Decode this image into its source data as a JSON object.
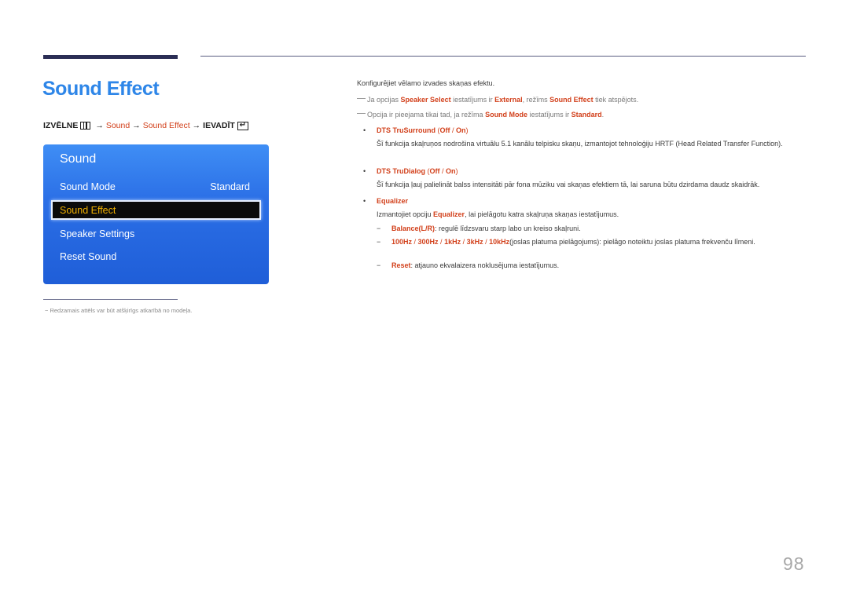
{
  "page": {
    "title": "Sound Effect",
    "page_number": "98"
  },
  "breadcrumb": {
    "menu_label": "IZVĒLNE",
    "menu_icon": "menu-grid-icon",
    "arrow": "→",
    "step1": "Sound",
    "step2": "Sound Effect",
    "enter_label": "IEVADĪT",
    "enter_icon": "enter-return-icon",
    "enter_glyph": "↵"
  },
  "osd_menu": {
    "title": "Sound",
    "items": [
      {
        "label": "Sound Mode",
        "value": "Standard"
      },
      {
        "label": "Sound Effect",
        "value": "",
        "selected": true
      },
      {
        "label": "Speaker Settings",
        "value": ""
      },
      {
        "label": "Reset Sound",
        "value": ""
      }
    ]
  },
  "footnote": "− Redzamais attēls var būt atšķirīgs atkarībā no modeļa.",
  "content": {
    "intro": "Konfigurējiet vēlamo izvades skaņas efektu.",
    "note1": {
      "t1": "Ja opcijas ",
      "k1": "Speaker Select",
      "t2": " iestatījums ir ",
      "k2": "External",
      "t3": ", režīms ",
      "k3": "Sound Effect",
      "t4": " tiek atspējots."
    },
    "note2": {
      "t1": "Opcija ir pieejama tikai tad, ja režīma ",
      "k1": "Sound Mode",
      "t2": " iestatījums ir ",
      "k2": "Standard",
      "t3": "."
    },
    "bullets": [
      {
        "name": "DTS TruSurround",
        "opt_open": " (",
        "opt1": "Off",
        "sep": " / ",
        "opt2": "On",
        "opt_close": ")",
        "desc": "Šī funkcija skaļruņos nodrošina virtuālu 5.1 kanālu telpisku skaņu, izmantojot tehnoloģiju HRTF (Head Related Transfer Function)."
      },
      {
        "name": "DTS TruDialog",
        "opt_open": " (",
        "opt1": "Off",
        "sep": " / ",
        "opt2": "On",
        "opt_close": ")",
        "desc": "Šī funkcija ļauj palielināt balss intensitāti pār fona mūziku vai skaņas efektiem tā, lai saruna būtu dzirdama daudz skaidrāk."
      },
      {
        "name": "Equalizer",
        "desc_t1": "Izmantojiet opciju ",
        "desc_k1": "Equalizer",
        "desc_t2": ", lai pielāgotu katra skaļruņa skaņas iestatījumus."
      }
    ],
    "bullet_glyph": "•",
    "sub_dash": "−",
    "equalizer_items": [
      {
        "key": "Balance(L/R)",
        "text": ": regulē līdzsvaru starp labo un kreiso skaļruni."
      },
      {
        "keys": [
          "100Hz",
          "300Hz",
          "1kHz",
          "3kHz",
          "10kHz"
        ],
        "sep": " / ",
        "text": "(joslas platuma pielāgojums): pielāgo noteiktu joslas platuma frekvenču līmeni."
      },
      {
        "key": "Reset",
        "text": ": atjauno ekvalaizera noklusējuma iestatījumus."
      }
    ]
  },
  "colors": {
    "title_blue": "#2e86e8",
    "accent_red": "#d2401b",
    "osd_blue": "#2b6fe6",
    "osd_highlight_text": "#f0b000",
    "header_bar": "#2b2e55"
  }
}
